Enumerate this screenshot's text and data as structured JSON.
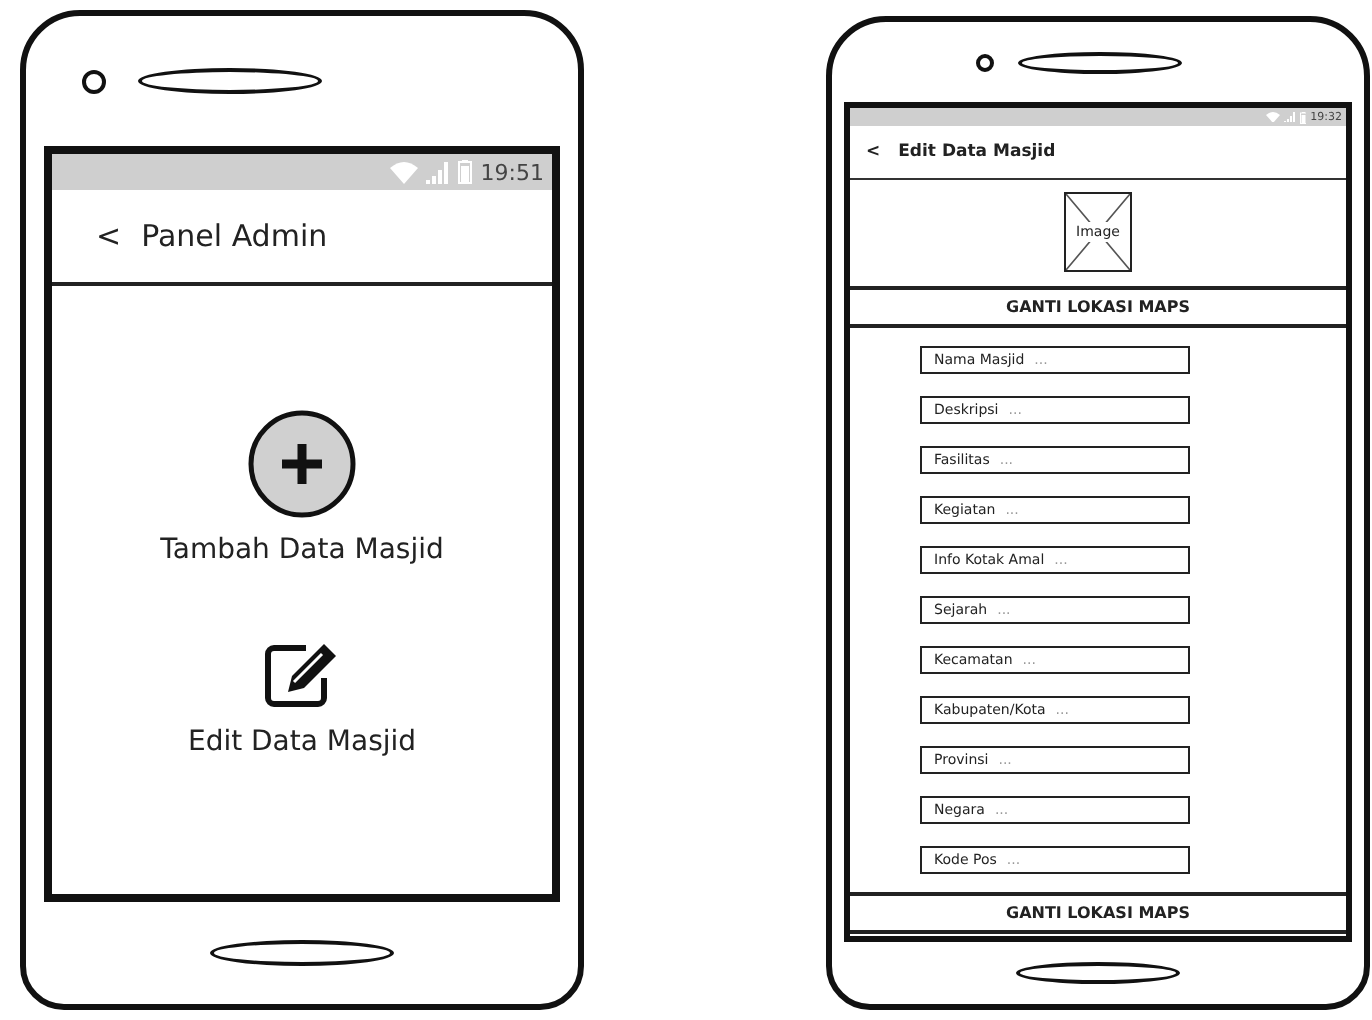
{
  "screens": [
    {
      "kind": "menu",
      "status_bar": {
        "time": "19:51"
      },
      "header": {
        "back": "<",
        "title": "Panel Admin"
      },
      "actions": [
        {
          "kind": "add",
          "label": "Tambah Data Masjid"
        },
        {
          "kind": "edit",
          "label": "Edit Data Masjid"
        }
      ]
    },
    {
      "kind": "form",
      "status_bar": {
        "time": "19:32"
      },
      "header": {
        "back": "<",
        "title": "Edit Data Masjid"
      },
      "image_placeholder": "Image",
      "top_button": "GANTI LOKASI MAPS",
      "fields": [
        {
          "label": "Nama Masjid",
          "hint": "..."
        },
        {
          "label": "Deskripsi",
          "hint": "..."
        },
        {
          "label": "Fasilitas",
          "hint": "..."
        },
        {
          "label": "Kegiatan",
          "hint": "..."
        },
        {
          "label": "Info Kotak Amal",
          "hint": "..."
        },
        {
          "label": "Sejarah",
          "hint": "..."
        },
        {
          "label": "Kecamatan",
          "hint": "..."
        },
        {
          "label": "Kabupaten/Kota",
          "hint": "..."
        },
        {
          "label": "Provinsi",
          "hint": "..."
        },
        {
          "label": "Negara",
          "hint": "..."
        },
        {
          "label": "Kode Pos",
          "hint": "..."
        }
      ],
      "bottom_button": "GANTI LOKASI MAPS"
    }
  ]
}
